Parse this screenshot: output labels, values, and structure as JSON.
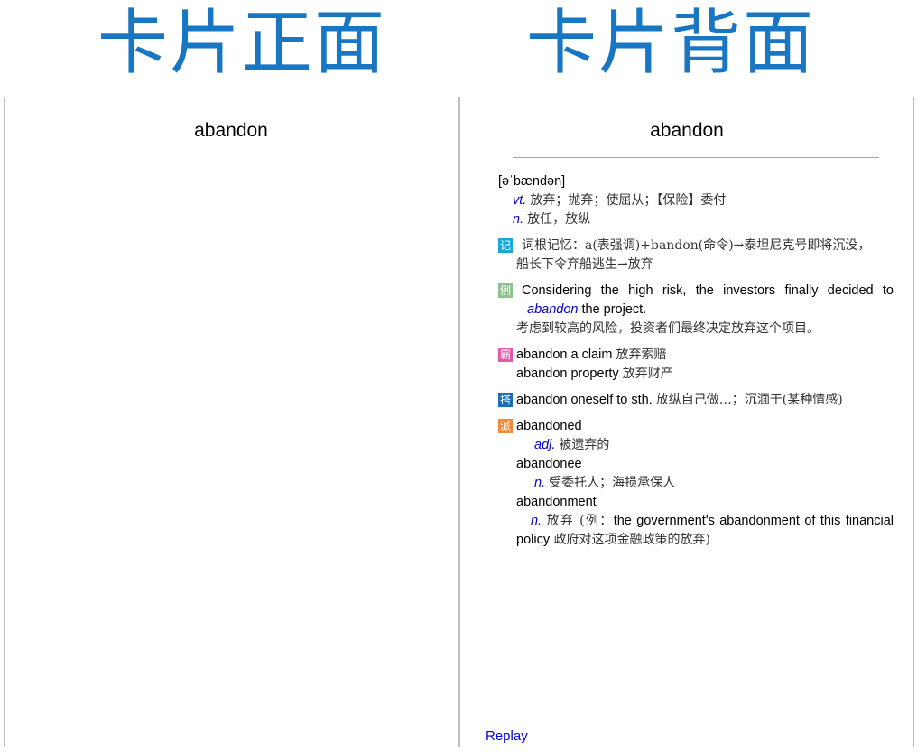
{
  "headings": {
    "front": "卡片正面",
    "back": "卡片背面"
  },
  "front_card": {
    "word": "abandon"
  },
  "back_card": {
    "word": "abandon",
    "pronunciation": "[əˈbændən]",
    "senses": [
      {
        "pos": "vt.",
        "meaning": "放弃；抛弃；使屈从；【保险】委付"
      },
      {
        "pos": "n.",
        "meaning": "放任，放纵"
      }
    ],
    "memory": {
      "icon": "记",
      "line1": "词根记忆：a(表强调)+bandon(命令)→泰坦尼克号即将沉没，",
      "line2": "船长下令弃船逃生→放弃"
    },
    "example": {
      "icon": "例",
      "en_before": "Considering the high risk, the investors finally decided to ",
      "en_highlight": "abandon",
      "en_after": " the project.",
      "zh": "考虑到较高的风险，投资者们最终决定放弃这个项目。"
    },
    "phrases": {
      "icon": "霸",
      "items": [
        {
          "en": "abandon a claim",
          "zh": "放弃索赔"
        },
        {
          "en": "abandon property",
          "zh": "放弃财产"
        }
      ]
    },
    "collocation": {
      "icon": "搭",
      "en": "abandon oneself to sth.",
      "zh": "放纵自己做…；沉湎于(某种情感)"
    },
    "derivatives": {
      "icon": "派",
      "items": [
        {
          "word": "abandoned",
          "pos": "adj.",
          "meaning": "被遗弃的"
        },
        {
          "word": "abandonee",
          "pos": "n.",
          "meaning": "受委托人；海损承保人"
        },
        {
          "word": "abandonment",
          "pos": "n.",
          "meaning_zh": "放弃",
          "meaning_rest_1": " (例：",
          "meaning_rest_en": "the government's abandonment of this financial policy",
          "meaning_rest_zh": " 政府对这项金融政策的放弃)"
        }
      ]
    },
    "replay_label": "Replay"
  },
  "colors": {
    "heading": "#1976c2",
    "pos": "#0000cc",
    "link": "#0000ee",
    "border": "#bdbdbd"
  }
}
